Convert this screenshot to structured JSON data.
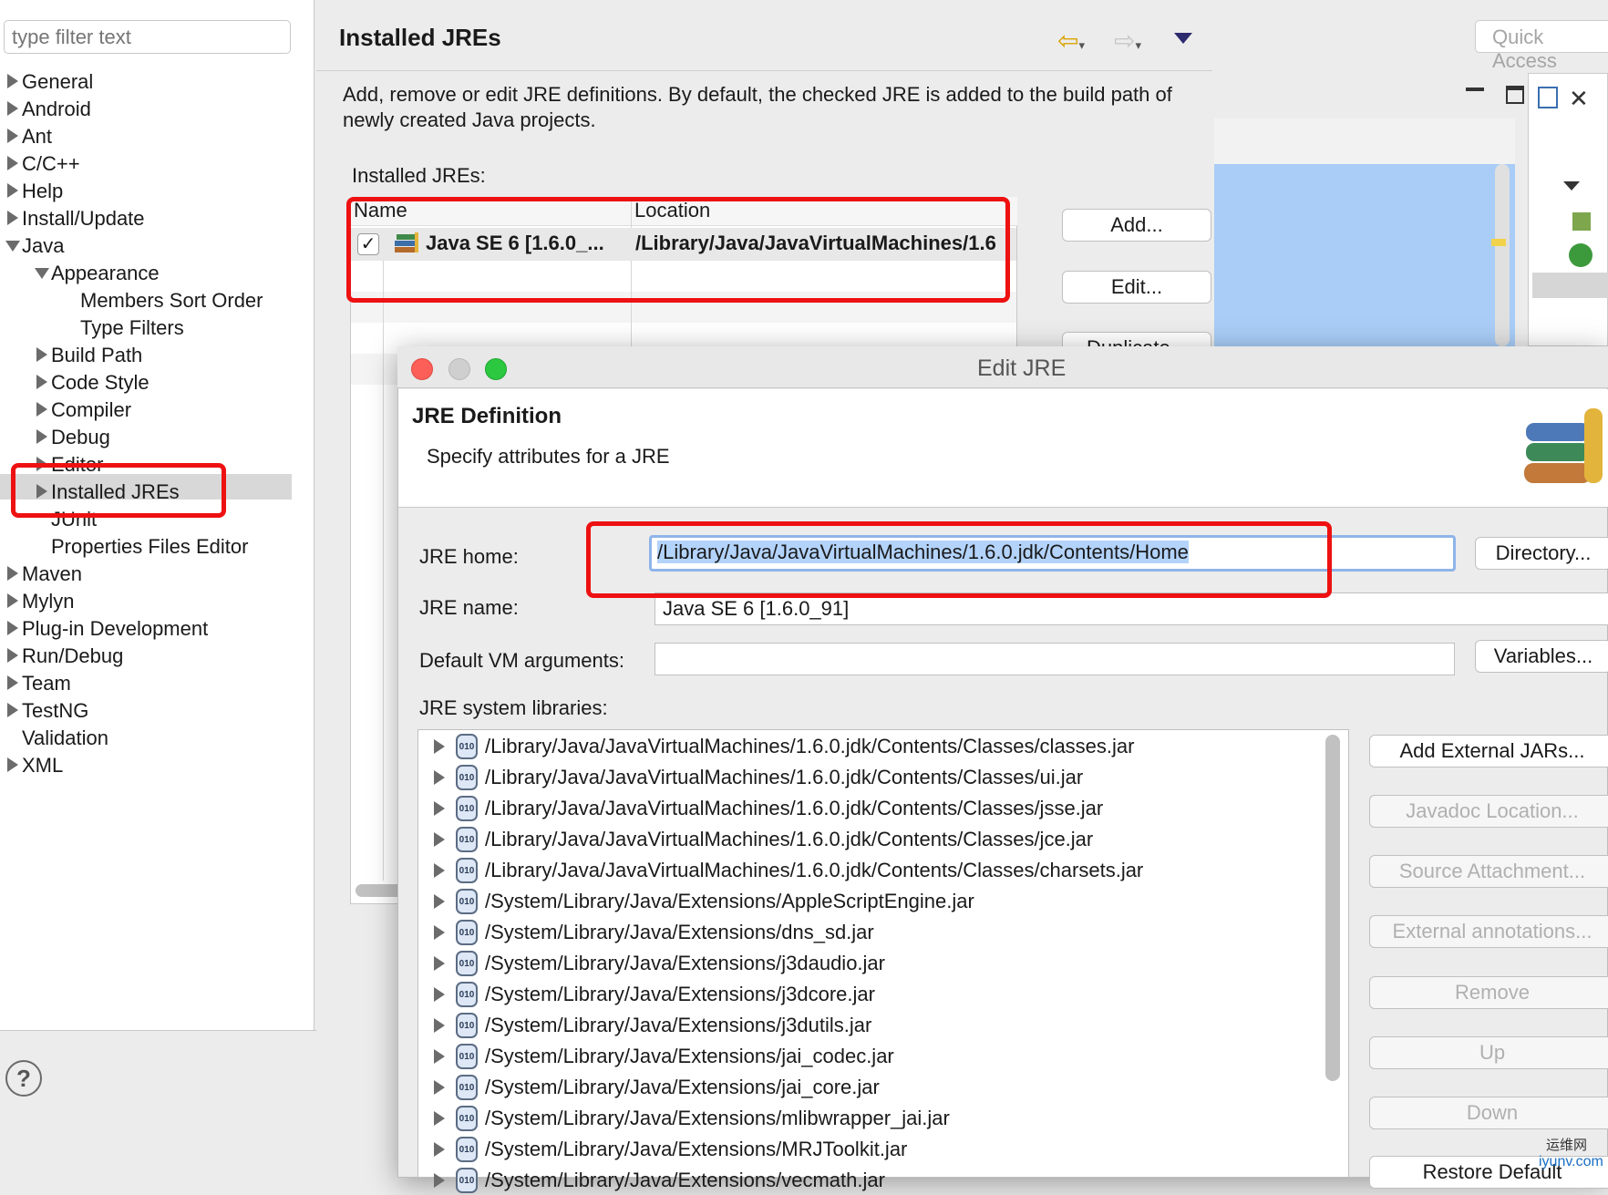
{
  "filter": {
    "placeholder": "type filter text"
  },
  "tree": [
    {
      "label": "General",
      "level": 0,
      "expanded": false
    },
    {
      "label": "Android",
      "level": 0,
      "expanded": false
    },
    {
      "label": "Ant",
      "level": 0,
      "expanded": false
    },
    {
      "label": "C/C++",
      "level": 0,
      "expanded": false
    },
    {
      "label": "Help",
      "level": 0,
      "expanded": false
    },
    {
      "label": "Install/Update",
      "level": 0,
      "expanded": false
    },
    {
      "label": "Java",
      "level": 0,
      "expanded": true
    },
    {
      "label": "Appearance",
      "level": 1,
      "expanded": true
    },
    {
      "label": "Members Sort Order",
      "level": 2
    },
    {
      "label": "Type Filters",
      "level": 2
    },
    {
      "label": "Build Path",
      "level": 1,
      "expanded": false
    },
    {
      "label": "Code Style",
      "level": 1,
      "expanded": false
    },
    {
      "label": "Compiler",
      "level": 1,
      "expanded": false
    },
    {
      "label": "Debug",
      "level": 1,
      "expanded": false
    },
    {
      "label": "Editor",
      "level": 1,
      "expanded": false
    },
    {
      "label": "Installed JREs",
      "level": 1,
      "expanded": false,
      "selected": true
    },
    {
      "label": "JUnit",
      "level": 1
    },
    {
      "label": "Properties Files Editor",
      "level": 1
    },
    {
      "label": "Maven",
      "level": 0,
      "expanded": false
    },
    {
      "label": "Mylyn",
      "level": 0,
      "expanded": false
    },
    {
      "label": "Plug-in Development",
      "level": 0,
      "expanded": false
    },
    {
      "label": "Run/Debug",
      "level": 0,
      "expanded": false
    },
    {
      "label": "Team",
      "level": 0,
      "expanded": false
    },
    {
      "label": "TestNG",
      "level": 0,
      "expanded": false
    },
    {
      "label": "Validation",
      "level": 0
    },
    {
      "label": "XML",
      "level": 0,
      "expanded": false
    }
  ],
  "page": {
    "title": "Installed JREs",
    "description": "Add, remove or edit JRE definitions. By default, the checked JRE is added to the build path of newly created Java projects.",
    "jres_label": "Installed JREs:",
    "col_name": "Name",
    "col_location": "Location",
    "jre_row": {
      "name": "Java SE 6 [1.6.0_...",
      "location": "/Library/Java/JavaVirtualMachines/1.6",
      "checked": true,
      "check_mark": "✓"
    },
    "buttons": {
      "add": "Add...",
      "edit": "Edit...",
      "duplicate": "Duplicate..."
    }
  },
  "toolbar": {
    "back_icon": "⇦",
    "fwd_icon": "⇨",
    "caret": "▾"
  },
  "quick_access": {
    "placeholder": "Quick Access"
  },
  "help": {
    "icon": "?"
  },
  "dialog": {
    "title": "Edit JRE",
    "heading": "JRE Definition",
    "subheading": "Specify attributes for a JRE",
    "home_label": "JRE home:",
    "home_value": "/Library/Java/JavaVirtualMachines/1.6.0.jdk/Contents/Home",
    "name_label": "JRE name:",
    "name_value": "Java SE 6 [1.6.0_91]",
    "vmargs_label": "Default VM arguments:",
    "vmargs_value": "",
    "libs_label": "JRE system libraries:",
    "jar_glyph": "010",
    "buttons": {
      "directory": "Directory...",
      "variables": "Variables...",
      "add_external": "Add External JARs...",
      "javadoc": "Javadoc Location...",
      "source": "Source Attachment...",
      "external_annotations": "External annotations...",
      "remove": "Remove",
      "up": "Up",
      "down": "Down",
      "restore": "Restore Default"
    },
    "libraries": [
      "/Library/Java/JavaVirtualMachines/1.6.0.jdk/Contents/Classes/classes.jar",
      "/Library/Java/JavaVirtualMachines/1.6.0.jdk/Contents/Classes/ui.jar",
      "/Library/Java/JavaVirtualMachines/1.6.0.jdk/Contents/Classes/jsse.jar",
      "/Library/Java/JavaVirtualMachines/1.6.0.jdk/Contents/Classes/jce.jar",
      "/Library/Java/JavaVirtualMachines/1.6.0.jdk/Contents/Classes/charsets.jar",
      "/System/Library/Java/Extensions/AppleScriptEngine.jar",
      "/System/Library/Java/Extensions/dns_sd.jar",
      "/System/Library/Java/Extensions/j3daudio.jar",
      "/System/Library/Java/Extensions/j3dcore.jar",
      "/System/Library/Java/Extensions/j3dutils.jar",
      "/System/Library/Java/Extensions/jai_codec.jar",
      "/System/Library/Java/Extensions/jai_core.jar",
      "/System/Library/Java/Extensions/mlibwrapper_jai.jar",
      "/System/Library/Java/Extensions/MRJToolkit.jar",
      "/System/Library/Java/Extensions/vecmath.jar"
    ]
  },
  "watermark": {
    "line1": "运维网",
    "line2": "iyunv.com"
  },
  "colors": {
    "highlight": "#ee1111",
    "selection": "#b3d3fb",
    "close": "#fc5f57",
    "minimize": "#cfcfcf",
    "zoom": "#2bc840"
  }
}
